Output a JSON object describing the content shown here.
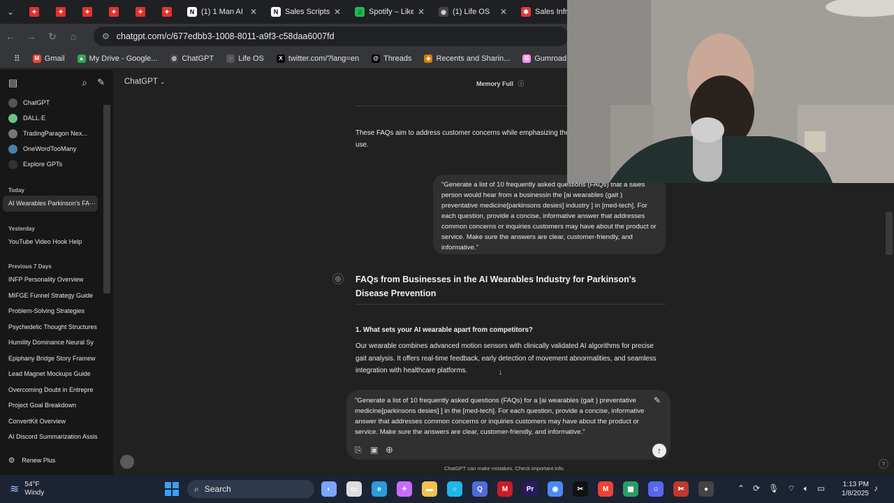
{
  "browser": {
    "pdf_tab_icons": [
      "PDF",
      "PDF",
      "PDF",
      "PDF",
      "PDF",
      "PDF"
    ],
    "tabs": [
      {
        "icon": "N",
        "label": "(1) 1 Man AI",
        "color": "#ffffff",
        "fg": "#000000"
      },
      {
        "icon": "N",
        "label": "Sales Scripts",
        "color": "#ffffff",
        "fg": "#000000"
      },
      {
        "icon": "♫",
        "label": "Spotify – Like",
        "color": "#1db954",
        "fg": "#000000"
      },
      {
        "icon": "◉",
        "label": "(1) Life OS",
        "color": "#444444",
        "fg": "#dddddd"
      },
      {
        "icon": "✱",
        "label": "Sales Infra",
        "color": "#e23a3a",
        "fg": "#ffffff"
      }
    ],
    "url": "chatgpt.com/c/677edbb3-1008-8011-a9f3-c58daa6007fd",
    "bookmarks": [
      {
        "label": "Gmail",
        "color": "#ea4335",
        "icon": "M"
      },
      {
        "label": "My Drive - Google...",
        "color": "#34a853",
        "icon": "▲"
      },
      {
        "label": "ChatGPT",
        "color": "#444444",
        "icon": "◎"
      },
      {
        "label": "Life OS",
        "color": "#555555",
        "icon": "◌"
      },
      {
        "label": "twitter.com/?lang=en",
        "color": "#000000",
        "icon": "X"
      },
      {
        "label": "Threads",
        "color": "#000000",
        "icon": "@"
      },
      {
        "label": "Recents and Sharin...",
        "color": "#e07a00",
        "icon": "◆"
      },
      {
        "label": "Gumroad – Sell wha...",
        "color": "#ff90e8",
        "icon": "G"
      }
    ]
  },
  "sidebar": {
    "gpts": [
      {
        "label": "ChatGPT",
        "color": "#555555"
      },
      {
        "label": "DALL·E",
        "color": "#6bc47d"
      },
      {
        "label": "TradingParagon Nex...",
        "color": "#777777"
      },
      {
        "label": "OneWordTooMany",
        "color": "#4a7fa8"
      },
      {
        "label": "Explore GPTs",
        "color": "#333333"
      }
    ],
    "today_label": "Today",
    "today": [
      "AI Wearables Parkinson's FA"
    ],
    "yesterday_label": "Yesterday",
    "yesterday": [
      "YouTube Video Hook Help"
    ],
    "prev7_label": "Previous 7 Days",
    "prev7": [
      "INFP Personality Overview",
      "MIFGE Funnel Strategy Guide",
      "Problem-Solving Strategies",
      "Psychedelic Thought Structures",
      "Humility Dominance Neural Sy",
      "Epiphany Bridge Story Framew",
      "Lead Magnet Mockups Guide",
      "Overcoming Doubt in Entrepre",
      "Project Goal Breakdown",
      "ConvertKit Overview",
      "AI Discord Summarization Assis"
    ],
    "renew_label": "Renew Plus"
  },
  "header": {
    "model": "ChatGPT",
    "memory": "Memory Full"
  },
  "chat": {
    "prev_answer": "These FAQs aim to address customer concerns while emphasizing the",
    "prev_answer_2": "use.",
    "user_message": "\"Generate a list of 10 frequently asked questions (FAQs) that a sales person would hear from a businessin the [ai wearables (gait ) preventative medicine[parkinsons desies] industry ] in [med-tech]. For each question, provide a concise, informative answer that addresses common concerns or inquiries customers may have about the product or service. Make sure the answers are clear, customer-friendly, and informative.\"",
    "answer_title": "FAQs from Businesses in the AI Wearables Industry for Parkinson's Disease Prevention",
    "q1": "1. What sets your AI wearable apart from competitors?",
    "a1": "Our wearable combines advanced motion sensors with clinically validated AI algorithms for precise gait analysis. It offers real-time feedback, early detection of movement abnormalities, and seamless integration with healthcare platforms."
  },
  "composer": {
    "text": "\"Generate a list of 10 frequently asked questions (FAQs) for a [ai wearables (gait ) preventative medicine[parkinsons desies] ] in the [med-tech]. For each question, provide a concise, informative answer that addresses common concerns or inquiries customers may have about the product or service. Make sure the answers are clear, customer-friendly, and informative.\"",
    "disclaimer": "ChatGPT can make mistakes. Check important info."
  },
  "taskbar": {
    "temp": "54°F",
    "weather": "Windy",
    "search": "Search",
    "time": "1:13 PM",
    "date": "1/8/2025"
  }
}
